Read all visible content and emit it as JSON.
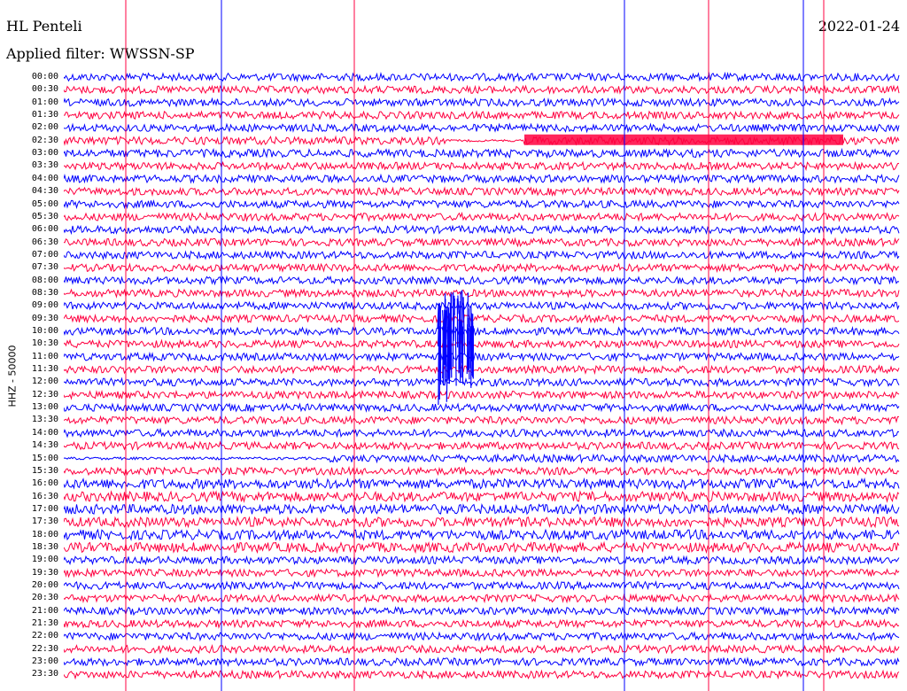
{
  "header": {
    "station": "HL Penteli",
    "date": "2022-01-24",
    "filter": "Applied filter: WWSSN-SP"
  },
  "channel_label": "HHZ - 50000",
  "trace_colors": [
    "#0000ff",
    "#ff0040"
  ],
  "time_labels": [
    "00:00",
    "00:30",
    "01:00",
    "01:30",
    "02:00",
    "02:30",
    "03:00",
    "03:30",
    "04:00",
    "04:30",
    "05:00",
    "05:30",
    "06:00",
    "06:30",
    "07:00",
    "07:30",
    "08:00",
    "08:30",
    "09:00",
    "09:30",
    "10:00",
    "10:30",
    "11:00",
    "11:30",
    "12:00",
    "12:30",
    "13:00",
    "13:30",
    "14:00",
    "14:30",
    "15:00",
    "15:30",
    "16:00",
    "16:30",
    "17:00",
    "17:30",
    "18:00",
    "18:30",
    "19:00",
    "19:30",
    "20:00",
    "20:30",
    "21:00",
    "21:30",
    "22:00",
    "22:30",
    "23:00",
    "23:30"
  ],
  "events": [
    {
      "label": "10:00",
      "description": "large event"
    }
  ]
}
